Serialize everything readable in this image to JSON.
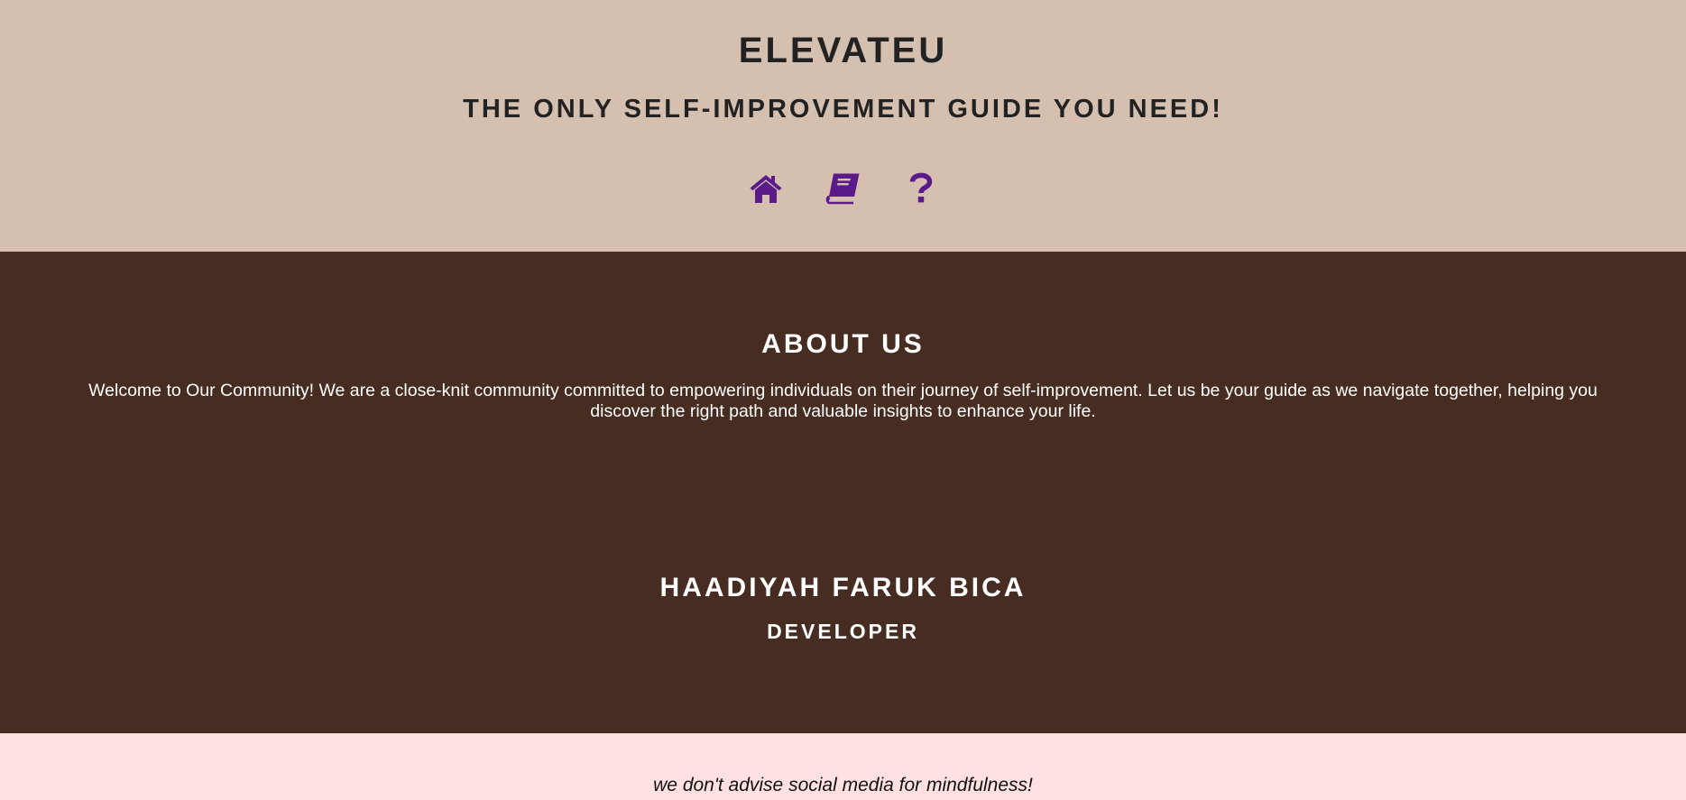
{
  "header": {
    "site_title": "ELEVATEU",
    "tagline": "THE ONLY SELF-IMPROVEMENT GUIDE YOU NEED!",
    "nav": [
      {
        "icon": "home-icon"
      },
      {
        "icon": "book-icon"
      },
      {
        "icon": "question-icon"
      }
    ],
    "icon_color": "#5a1a8a",
    "background": "#d5c0b0"
  },
  "about": {
    "heading": "ABOUT US",
    "text": "Welcome to Our Community! We are a close-knit community committed to empowering individuals on their journey of self-improvement. Let us be your guide as we navigate together, helping you discover the right path and valuable insights to enhance your life.",
    "member": {
      "name": "HAADIYAH FARUK BICA",
      "role": "DEVELOPER"
    },
    "background": "#472d21"
  },
  "footer": {
    "note": "we don't advise social media for mindfulness!",
    "background": "#ffe1e1"
  }
}
